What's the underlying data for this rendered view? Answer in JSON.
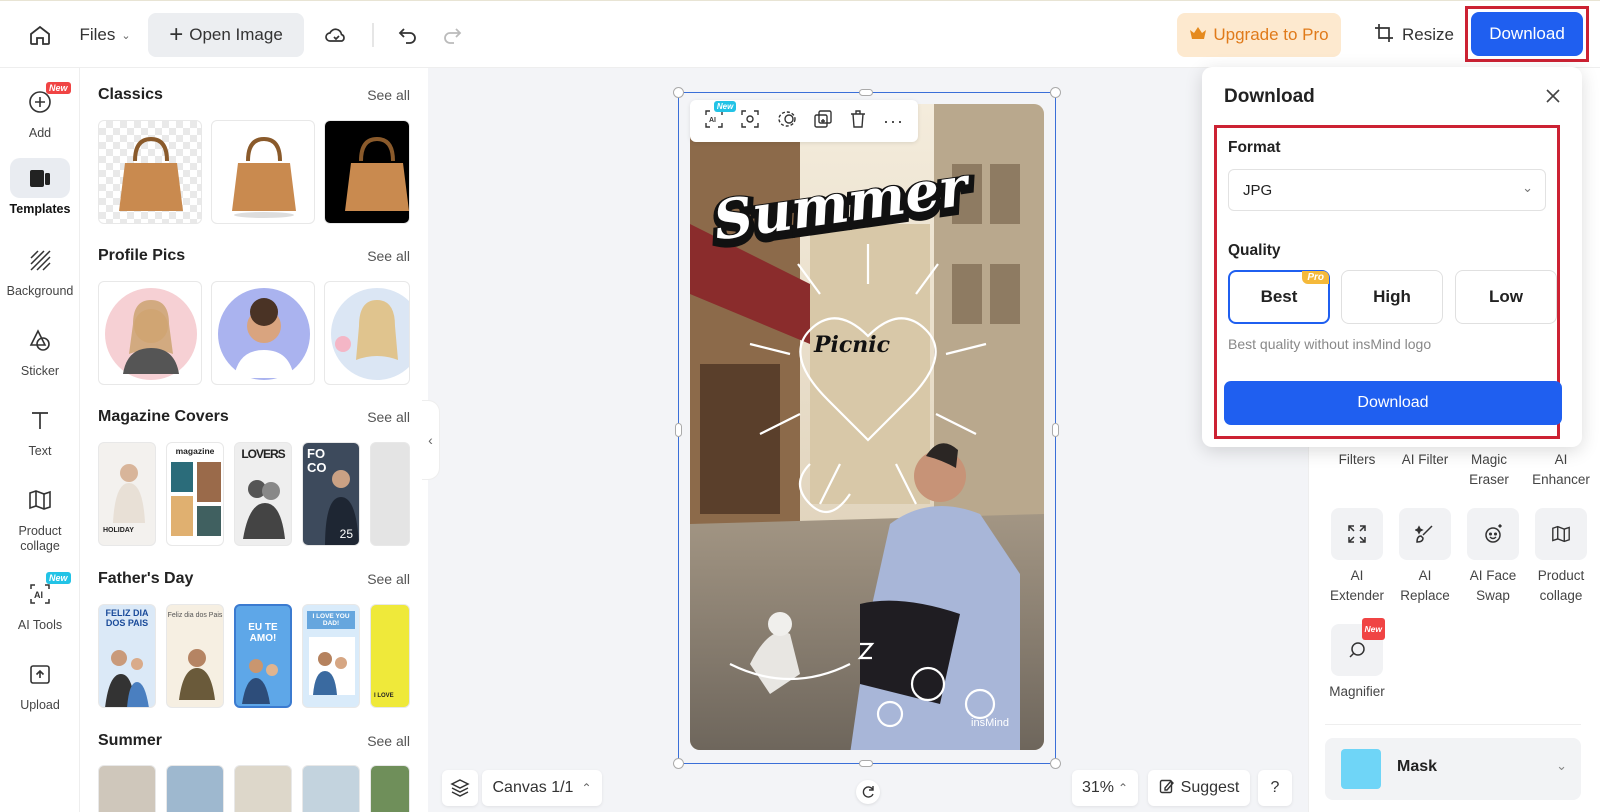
{
  "topbar": {
    "files_label": "Files",
    "open_image_label": "Open Image",
    "upgrade_label": "Upgrade to Pro",
    "resize_label": "Resize",
    "download_label": "Download"
  },
  "rail": {
    "items": [
      {
        "label": "Add",
        "icon": "add-icon",
        "badge": "New"
      },
      {
        "label": "Templates",
        "icon": "templates-icon"
      },
      {
        "label": "Background",
        "icon": "background-icon"
      },
      {
        "label": "Sticker",
        "icon": "sticker-icon"
      },
      {
        "label": "Text",
        "icon": "text-icon"
      },
      {
        "label": "Product collage",
        "icon": "product-collage-icon"
      },
      {
        "label": "AI Tools",
        "icon": "ai-tools-icon",
        "badge": "New"
      },
      {
        "label": "Upload",
        "icon": "upload-icon"
      }
    ]
  },
  "templates": {
    "sections": [
      {
        "title": "Classics",
        "see_all": "See all"
      },
      {
        "title": "Profile Pics",
        "see_all": "See all"
      },
      {
        "title": "Magazine Covers",
        "see_all": "See all"
      },
      {
        "title": "Father's Day",
        "see_all": "See all"
      },
      {
        "title": "Summer",
        "see_all": "See all"
      }
    ],
    "magazine_texts": {
      "t1": "HOLIDAY",
      "t2": "magazine",
      "t3": "LOVERS",
      "t4": "FOCO",
      "t5": "25"
    },
    "fathers_texts": {
      "t1": "FELIZ DIA DOS PAIS",
      "t2": "Feliz dia dos Pais",
      "t3": "EU TE AMO!",
      "t4": "I LOVE YOU DAD!",
      "t5": "I LOVE"
    }
  },
  "canvas": {
    "toolbar_badge": "New",
    "design_title": "Summer",
    "design_subtitle": "Picnic",
    "watermark": "insMind",
    "canvas_label": "Canvas 1/1",
    "zoom": "31%",
    "suggest_label": "Suggest",
    "help_label": "?"
  },
  "download_popup": {
    "title": "Download",
    "format_label": "Format",
    "format_value": "JPG",
    "quality_label": "Quality",
    "quality_options": [
      "Best",
      "High",
      "Low"
    ],
    "selected_quality": "Best",
    "pro_badge": "Pro",
    "quality_hint": "Best quality without insMind logo",
    "download_button": "Download"
  },
  "right_panel": {
    "tools_row1": [
      "Filters",
      "AI Filter",
      "Magic Eraser",
      "AI Enhancer"
    ],
    "tools_row2": [
      "AI Extender",
      "AI Replace",
      "AI Face Swap",
      "Product collage"
    ],
    "tools_row3": [
      "Magnifier"
    ],
    "magnifier_badge": "New",
    "mask_label": "Mask"
  },
  "colors": {
    "accent": "#1f5ff0",
    "highlight": "#cc2233",
    "upgrade_bg": "#fde9cf",
    "upgrade_text": "#e07a1a"
  }
}
